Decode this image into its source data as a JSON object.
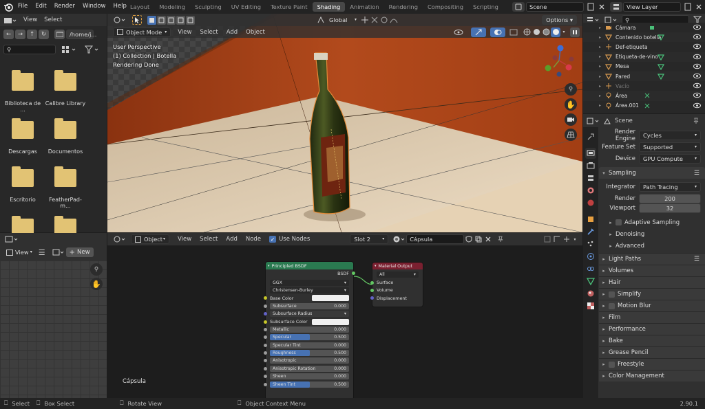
{
  "topbar": {
    "menu": [
      "File",
      "Edit",
      "Render",
      "Window",
      "Help"
    ],
    "workspaces": [
      "Layout",
      "Modeling",
      "Sculpting",
      "UV Editing",
      "Texture Paint",
      "Shading",
      "Animation",
      "Rendering",
      "Compositing",
      "Scripting"
    ],
    "active_workspace": "Shading",
    "scene": "Scene",
    "view_layer": "View Layer"
  },
  "file_browser": {
    "menu": [
      "View",
      "Select"
    ],
    "path": "/home/j...",
    "items": [
      "Biblioteca de ...",
      "Calibre Library",
      "Descargas",
      "Documentos",
      "Escritorio",
      "FeatherPad-m...",
      "",
      ""
    ]
  },
  "image_editor": {
    "view": "View",
    "new_label": "New"
  },
  "viewport": {
    "mode": "Object Mode",
    "menu": [
      "View",
      "Select",
      "Add",
      "Object"
    ],
    "orientation": "Global",
    "options": "Options",
    "info": [
      "User Perspective",
      "(1) Collection | Botella",
      "Rendering Done"
    ]
  },
  "node_editor": {
    "type": "Object",
    "menu": [
      "View",
      "Select",
      "Add",
      "Node"
    ],
    "use_nodes": "Use Nodes",
    "slot": "Slot 2",
    "material": "Cápsula",
    "label": "Cápsula",
    "bsdf": {
      "title": "Principled BSDF",
      "output": "BSDF",
      "distribution": "GGX",
      "subsurface_method": "Christensen-Burley",
      "base_color": "Base Color",
      "subsurface_radius": "Subsurface Radius",
      "subsurface_color": "Subsurface Color",
      "params": [
        {
          "label": "Subsurface",
          "value": "0.000",
          "fill": 0
        },
        {
          "label": "Metallic",
          "value": "0.000",
          "fill": 0
        },
        {
          "label": "Specular",
          "value": "0.500",
          "fill": 0.5
        },
        {
          "label": "Specular Tint",
          "value": "0.000",
          "fill": 0
        },
        {
          "label": "Roughness",
          "value": "0.500",
          "fill": 0.5
        },
        {
          "label": "Anisotropic",
          "value": "0.000",
          "fill": 0
        },
        {
          "label": "Anisotropic Rotation",
          "value": "0.000",
          "fill": 0
        },
        {
          "label": "Sheen",
          "value": "0.000",
          "fill": 0
        },
        {
          "label": "Sheen Tint",
          "value": "0.500",
          "fill": 0.5
        }
      ]
    },
    "output": {
      "title": "Material Output",
      "target": "All",
      "sockets": [
        "Surface",
        "Volume",
        "Displacement"
      ]
    }
  },
  "outliner": {
    "items": [
      {
        "name": "Cámara",
        "kind": "camera"
      },
      {
        "name": "Contenido botella",
        "kind": "mesh"
      },
      {
        "name": "Def-etiqueta",
        "kind": "empty"
      },
      {
        "name": "Etiqueta-de-vino",
        "kind": "mesh"
      },
      {
        "name": "Mesa",
        "kind": "mesh"
      },
      {
        "name": "Pared",
        "kind": "mesh"
      },
      {
        "name": "Vacío",
        "kind": "empty"
      },
      {
        "name": "Área",
        "kind": "light"
      },
      {
        "name": "Área.001",
        "kind": "light"
      }
    ]
  },
  "properties": {
    "context": "Scene",
    "render_engine_label": "Render Engine",
    "render_engine": "Cycles",
    "feature_set_label": "Feature Set",
    "feature_set": "Supported",
    "device_label": "Device",
    "device": "GPU Compute",
    "sampling": "Sampling",
    "integrator_label": "Integrator",
    "integrator": "Path Tracing",
    "render_label": "Render",
    "render_samples": "200",
    "viewport_label": "Viewport",
    "viewport_samples": "32",
    "sub_sections": [
      "Adaptive Sampling",
      "Denoising",
      "Advanced"
    ],
    "sections": [
      "Light Paths",
      "Volumes",
      "Hair",
      "Simplify",
      "Motion Blur",
      "Film",
      "Performance",
      "Bake",
      "Grease Pencil",
      "Freestyle",
      "Color Management"
    ]
  },
  "statusbar": {
    "items": [
      "Select",
      "Box Select",
      "Rotate View",
      "Object Context Menu"
    ],
    "version": "2.90.1"
  }
}
